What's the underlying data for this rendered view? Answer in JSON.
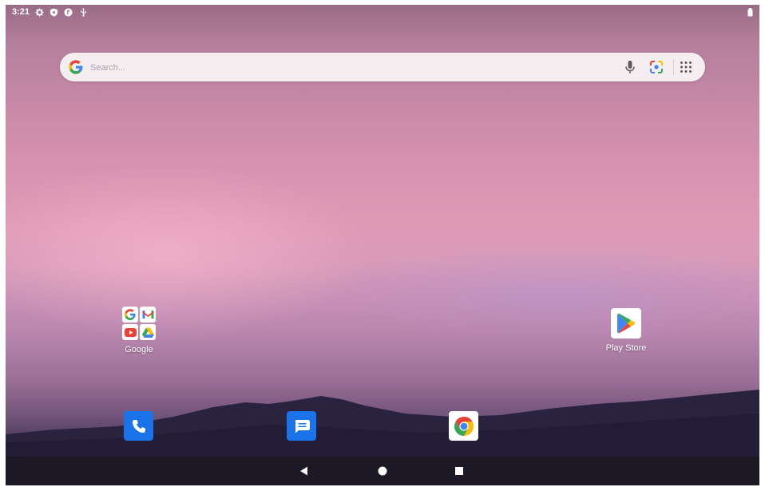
{
  "status_bar": {
    "time": "3:21",
    "icons": [
      "settings-gear-icon",
      "shield-icon",
      "security-badge-icon",
      "usb-icon"
    ],
    "battery_icon": "battery-icon"
  },
  "search": {
    "placeholder": "Search...",
    "value": "",
    "icons": [
      "google-g-icon",
      "mic-icon",
      "lens-icon",
      "apps-grid-icon"
    ]
  },
  "desktop": {
    "folder": {
      "label": "Google",
      "apps": [
        "google-search-icon",
        "gmail-icon",
        "youtube-icon",
        "drive-icon"
      ]
    },
    "apps": [
      {
        "label": "Play Store",
        "icon": "play-store-icon"
      }
    ]
  },
  "dock": {
    "apps": [
      "phone-icon",
      "messages-icon",
      "chrome-icon"
    ]
  },
  "navigation": {
    "buttons": [
      "back-icon",
      "home-icon",
      "recents-icon"
    ]
  },
  "colors": {
    "google_blue": "#4285F4",
    "google_red": "#EA4335",
    "google_yellow": "#FBBC05",
    "google_green": "#34A853",
    "dock_blue": "#1a73e8",
    "nav_bar": "#1c1826"
  }
}
